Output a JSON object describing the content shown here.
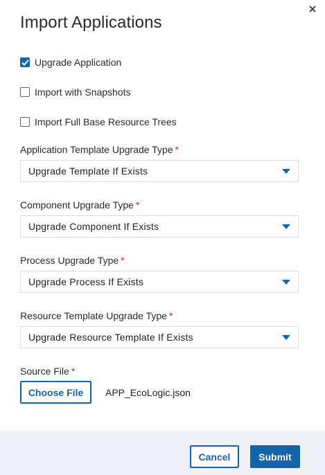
{
  "dialog": {
    "title": "Import Applications",
    "close_icon": "close-icon"
  },
  "options": [
    {
      "label": "Upgrade Application",
      "checked": true
    },
    {
      "label": "Import with Snapshots",
      "checked": false
    },
    {
      "label": "Import Full Base Resource Trees",
      "checked": false
    }
  ],
  "fields": [
    {
      "label": "Application Template Upgrade Type",
      "required_mark": "*",
      "value": "Upgrade Template If Exists"
    },
    {
      "label": "Component Upgrade Type",
      "required_mark": "*",
      "value": "Upgrade Component If Exists"
    },
    {
      "label": "Process Upgrade Type",
      "required_mark": "*",
      "value": "Upgrade Process If Exists"
    },
    {
      "label": "Resource Template Upgrade Type",
      "required_mark": "*",
      "value": "Upgrade Resource Template If Exists"
    }
  ],
  "source_file": {
    "label": "Source File",
    "required_mark": "*",
    "button_label": "Choose File",
    "file_name": "APP_EcoLogic.json"
  },
  "footer": {
    "cancel_label": "Cancel",
    "submit_label": "Submit"
  },
  "colors": {
    "accent": "#1464ac",
    "required": "#d4252b",
    "footer_bg": "#eef2f8"
  }
}
